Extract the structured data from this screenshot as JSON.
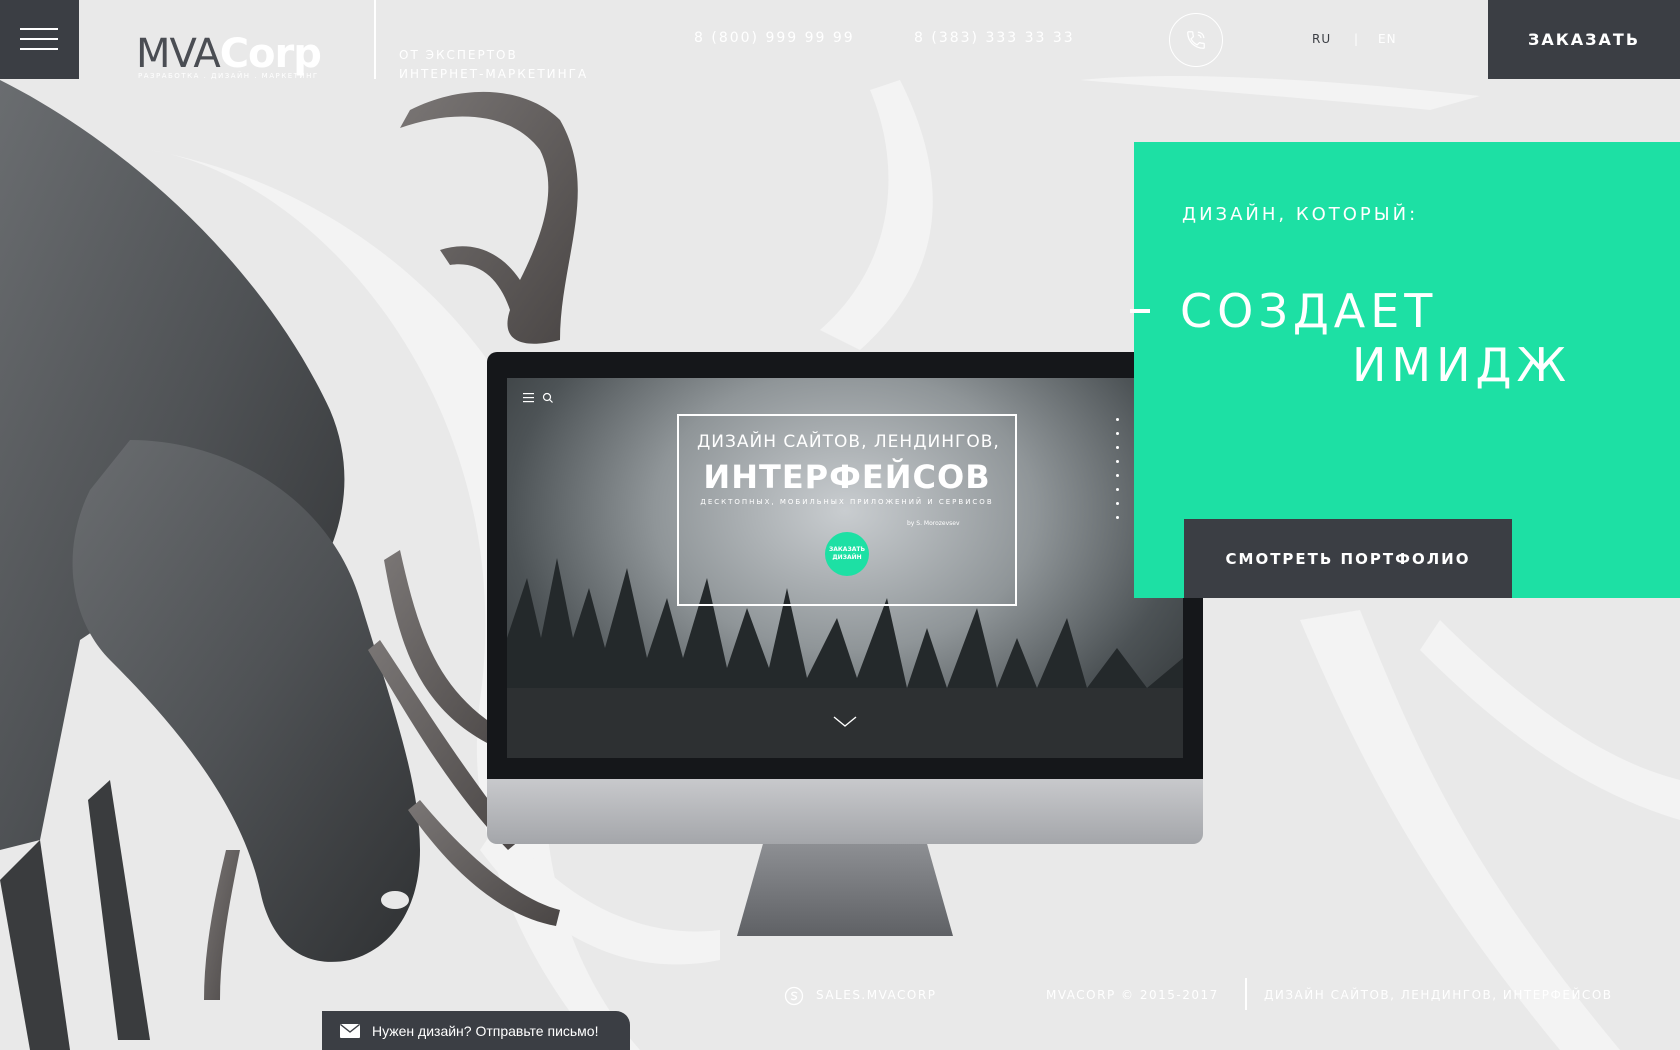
{
  "header": {
    "logo_main": "MVA",
    "logo_accent": "Corp",
    "logo_sub": "разработка . дизайн . маркетинг",
    "tagline": [
      "от экспертов",
      "интернет-маркетинга"
    ],
    "phones": [
      "8 (800) 999 99 99",
      "8 (383) 333 33 33"
    ],
    "languages": {
      "ru": "RU",
      "separator": "|",
      "en": "EN"
    },
    "order_label": "ЗАКАЗАТЬ"
  },
  "monitor_screen": {
    "title_small": "ДИЗАЙН САЙТОВ, ЛЕНДИНГОВ,",
    "title_big": "ИНТЕРФЕЙСОВ",
    "subtitle": "десктопных, мобильных приложений и сервисов",
    "author": "by S. Morozevsev",
    "cta_line1": "ЗАКАЗАТЬ",
    "cta_line2": "ДИЗАЙН"
  },
  "promo": {
    "label": "ДИЗАЙН, КОТОРЫЙ:",
    "line1": "СОЗДАЕТ",
    "line2": "ИМИДЖ",
    "button": "СМОТРЕТЬ ПОРТФОЛИО"
  },
  "footer": {
    "skype": "SALES.MVACORP",
    "copyright": "MVACORP © 2015-2017",
    "services": "ДИЗАЙН САЙТОВ, ЛЕНДИНГОВ, ИНТЕРФЕЙСОВ"
  },
  "mail_widget": {
    "text": "Нужен дизайн? Отправьте письмо!"
  },
  "colors": {
    "accent": "#1de0a4",
    "dark": "#3b3e44",
    "background": "#e9e9e9"
  },
  "icons": [
    "menu-icon",
    "phone-icon",
    "skype-icon",
    "mail-icon",
    "chevron-down-icon",
    "search-icon"
  ]
}
